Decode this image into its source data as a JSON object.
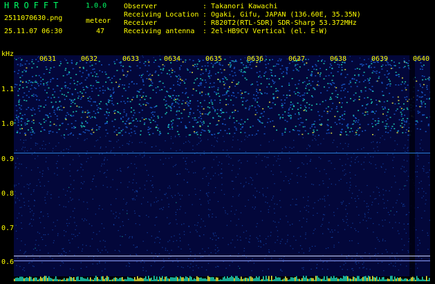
{
  "app": {
    "name": "HROFFT",
    "version": "1.0.0"
  },
  "file": {
    "filename": "2511070630.png",
    "timestamp": "25.11.07 06:30"
  },
  "meteor": {
    "label": "meteor",
    "count": "47"
  },
  "info": [
    {
      "key": "Observer",
      "value": ": Takanori Kawachi"
    },
    {
      "key": "Receiving Location",
      "value": ": Ogaki, Gifu, JAPAN (136.60E, 35.35N)"
    },
    {
      "key": "Receiver",
      "value": ": R820T2(RTL-SDR) SDR-Sharp 53.372MHz"
    },
    {
      "key": "Receiving antenna",
      "value": ": 2el-HB9CV Vertical (el. E-W)"
    }
  ],
  "spectrogram": {
    "y_unit": "kHz",
    "y_ticks": [
      "1.1",
      "1.0",
      "0.9",
      "0.8",
      "0.7",
      "0.6"
    ],
    "x_ticks": [
      "0631",
      "0632",
      "0633",
      "0634",
      "0635",
      "0636",
      "0637",
      "0638",
      "0639",
      "0640"
    ],
    "colors": {
      "background": "#03073a",
      "mid": "#1a5fd6",
      "high": "#22e6c8",
      "peak": "#ffff44",
      "label": "#ffff00"
    }
  }
}
